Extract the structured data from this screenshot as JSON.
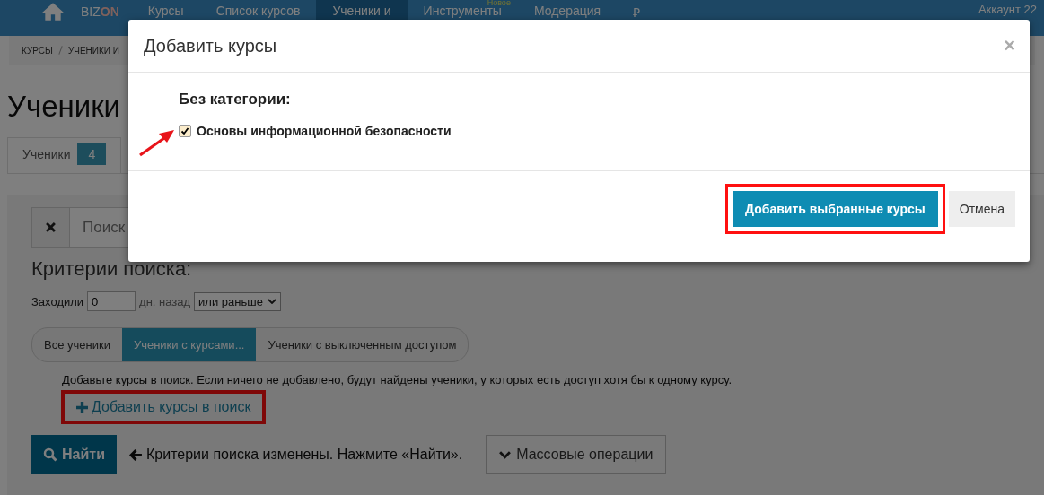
{
  "navbar": {
    "logo_main": "BIZ",
    "logo_accent": "ON",
    "items": [
      {
        "label": "Курсы",
        "selected": false
      },
      {
        "label": "Список курсов",
        "selected": false
      },
      {
        "label": "Ученики и",
        "selected": true
      },
      {
        "label": "Инструменты",
        "selected": false,
        "badge": "Новое"
      },
      {
        "label": "Модерация",
        "selected": false
      },
      {
        "label": "₽",
        "selected": false
      }
    ],
    "account": "Аккаунт 22"
  },
  "breadcrumb": [
    "КУРСЫ",
    "УЧЕНИКИ И"
  ],
  "heading": "Ученики",
  "tabs": [
    {
      "label": "Ученики",
      "count": "4",
      "selected": true
    }
  ],
  "search": {
    "placeholder": "Поиск"
  },
  "criteria": {
    "title": "Критерии поиска:",
    "visited_label": "Заходили",
    "days_value": "0",
    "days_suffix": "дн. назад",
    "when": "или раньше",
    "filters": [
      {
        "label": "Все ученики",
        "selected": false
      },
      {
        "label": "Ученики с курсами...",
        "selected": true
      },
      {
        "label": "Ученики с выключенным доступом",
        "selected": false
      }
    ],
    "hint": "Добавьте курсы в поиск. Если ничего не добавлено, будут найдены ученики, у которых есть доступ хотя бы к одному курсу.",
    "add_link": "Добавить курсы в поиск",
    "add_link_highlighted": true
  },
  "find_button": "Найти",
  "message": "Критерии поиска изменены. Нажмите «Найти».",
  "bulk_button": "Массовые операции",
  "modal": {
    "title": "Добавить курсы",
    "close": "×",
    "group": "Без категории:",
    "courses": [
      {
        "label": "Основы информационной безопасности",
        "checked": true,
        "pointed": true
      }
    ],
    "primary": "Добавить выбранные курсы",
    "primary_highlighted": true,
    "cancel": "Отмена"
  }
}
